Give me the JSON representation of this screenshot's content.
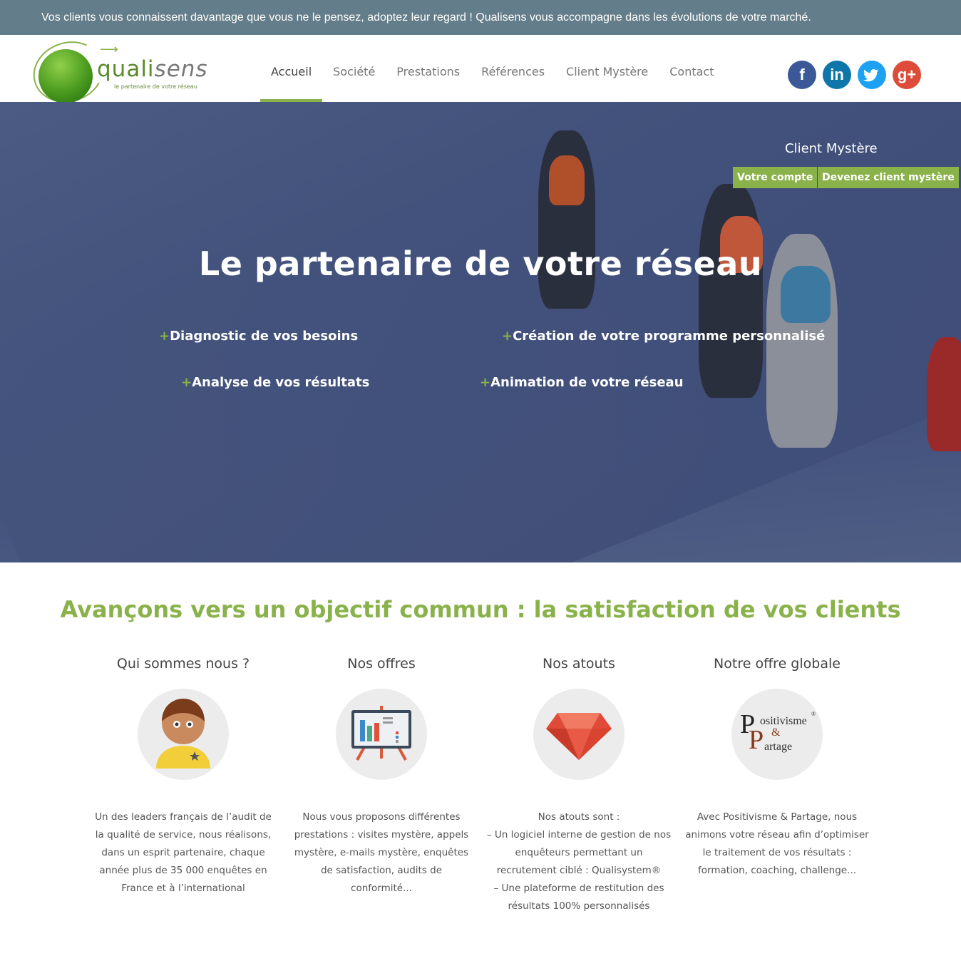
{
  "topbar": {
    "message": "Vos clients vous connaissent davantage que vous ne le pensez, adoptez leur regard ! Qualisens vous accompagne dans les évolutions de votre marché."
  },
  "logo": {
    "word_first": "quali",
    "word_second": "sens",
    "tagline": "le partenaire de votre réseau"
  },
  "nav": {
    "items": [
      {
        "label": "Accueil",
        "active": true
      },
      {
        "label": "Société"
      },
      {
        "label": "Prestations"
      },
      {
        "label": "Références"
      },
      {
        "label": "Client Mystère"
      },
      {
        "label": "Contact"
      }
    ]
  },
  "social": {
    "facebook": "f",
    "linkedin": "in",
    "twitter": "t",
    "googleplus": "g+"
  },
  "hero": {
    "client_mystere_title": "Client Mystère",
    "btn_account": "Votre compte",
    "btn_become": "Devenez client mystère",
    "title": "Le partenaire de votre réseau",
    "features": [
      "Diagnostic de vos besoins",
      "Création de votre programme personnalisé",
      "Analyse de vos résultats",
      "Animation de votre réseau"
    ],
    "plus_symbol": "+"
  },
  "main": {
    "section_title": "Avançons vers un objectif commun : la satisfaction de vos clients",
    "columns": [
      {
        "title": "Qui sommes nous ?",
        "icon": "person-icon",
        "text": "Un des leaders français de l’audit de la qualité de service, nous réalisons, dans un esprit partenaire, chaque année plus de 35 000 enquêtes en France et à l’international"
      },
      {
        "title": "Nos offres",
        "icon": "presentation-board-icon",
        "text": "Nous vous proposons différentes prestations : visites mystère, appels mystère, e-mails mystère, enquêtes de satisfaction, audits de conformité..."
      },
      {
        "title": "Nos atouts",
        "icon": "gem-icon",
        "text_lines": [
          "Nos atouts sont :",
          "– Un logiciel interne de gestion de nos enquêteurs permettant un recrutement ciblé : Qualisystem®",
          "– Une plateforme de restitution des résultats 100% personnalisés"
        ]
      },
      {
        "title": "Notre offre globale",
        "icon": "positivisme-partage-logo",
        "logo_text": {
          "p1": "ositivisme",
          "amp": "&",
          "p2": "artage",
          "reg": "®"
        },
        "text": "Avec Positivisme & Partage, nous animons votre réseau afin d’optimiser le traitement de vos résultats : formation, coaching, challenge..."
      }
    ]
  },
  "colors": {
    "accent_green": "#8ab24a",
    "topbar_bg": "#647d8a",
    "hero_blue": "#2a3d6a"
  }
}
